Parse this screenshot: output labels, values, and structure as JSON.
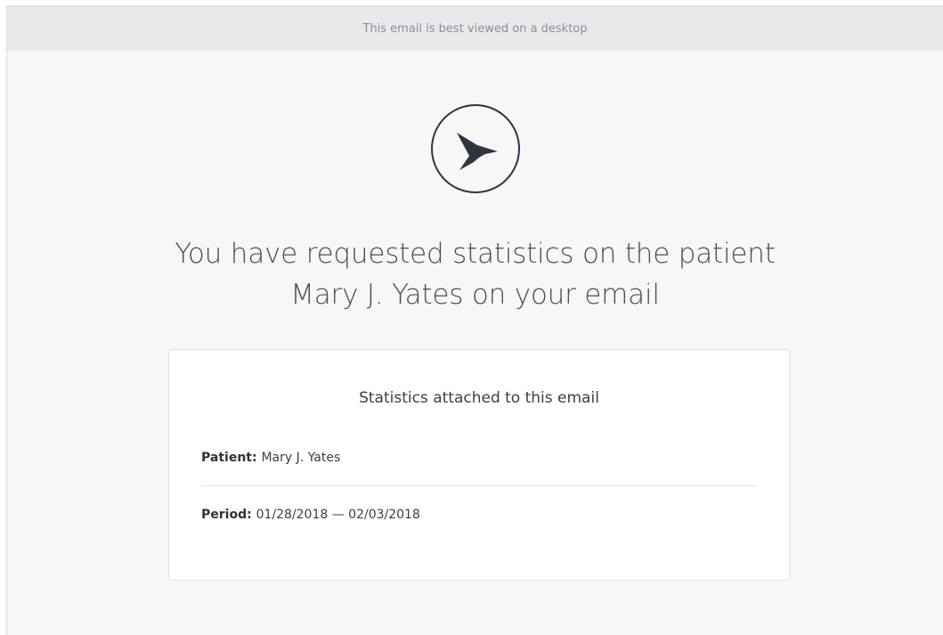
{
  "banner": {
    "text": "This email is best viewed on a desktop"
  },
  "logo": {
    "icon": "hummingbird-icon",
    "color": "#2e3440"
  },
  "headline": {
    "line1": "You have requested statistics on the patient",
    "line2": "Mary J. Yates on your email"
  },
  "card": {
    "title": "Statistics attached to this email",
    "patient_label": "Patient:",
    "patient_value": "Mary J. Yates",
    "period_label": "Period:",
    "period_value": "01/28/2018 — 02/03/2018"
  }
}
